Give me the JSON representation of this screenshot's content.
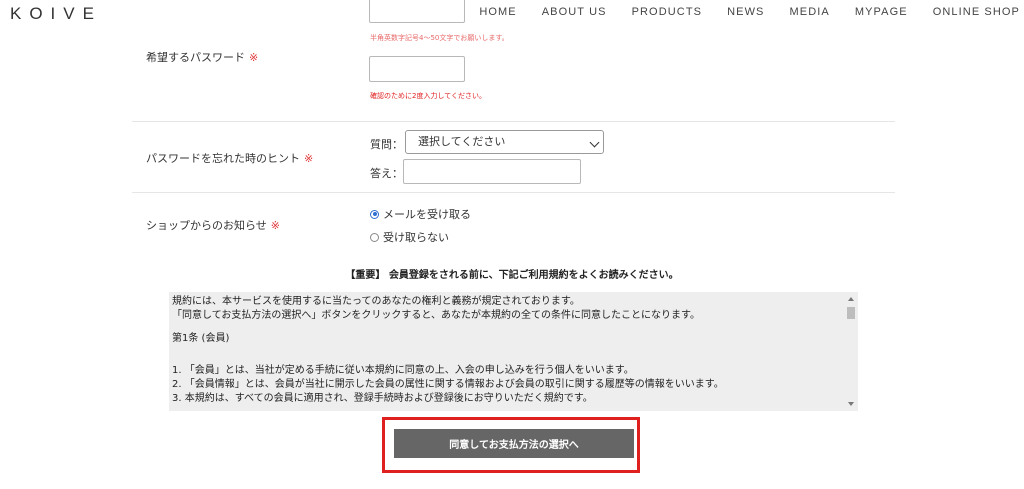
{
  "header": {
    "logo": "KOIVE",
    "nav": [
      "HOME",
      "ABOUT US",
      "PRODUCTS",
      "NEWS",
      "MEDIA",
      "MYPAGE",
      "ONLINE SHOP"
    ]
  },
  "password": {
    "label": "希望するパスワード",
    "required_mark": "※",
    "hint_format": "半角英数字記号4～50文字でお願いします。",
    "hint_confirm": "確認のために2度入力してください。",
    "value": "",
    "confirm_value": ""
  },
  "password_hint": {
    "label": "パスワードを忘れた時のヒント",
    "required_mark": "※",
    "question_label": "質問：",
    "question_selected": "選択してください",
    "answer_label": "答え：",
    "answer_value": ""
  },
  "newsletter": {
    "label": "ショップからのお知らせ",
    "required_mark": "※",
    "options": [
      {
        "label": "メールを受け取る",
        "selected": true
      },
      {
        "label": "受け取らない",
        "selected": false
      }
    ]
  },
  "terms": {
    "notice": "【重要】 会員登録をされる前に、下記ご利用規約をよくお読みください。",
    "lines": [
      "規約には、本サービスを使用するに当たってのあなたの権利と義務が規定されております。",
      "「同意してお支払方法の選択へ」ボタンをクリックすると、あなたが本規約の全ての条件に同意したことになります。",
      "第1条 (会員)",
      "1. 「会員」とは、当社が定める手続に従い本規約に同意の上、入会の申し込みを行う個人をいいます。",
      "2. 「会員情報」とは、会員が当社に開示した会員の属性に関する情報および会員の取引に関する履歴等の情報をいいます。",
      "3. 本規約は、すべての会員に適用され、登録手続時および登録後にお守りいただく規約です。"
    ]
  },
  "submit": {
    "label": "同意してお支払方法の選択へ"
  },
  "colors": {
    "required": "#e03a3a",
    "highlight": "#e0201e",
    "button": "#666666",
    "terms_bg": "#eeeeee"
  }
}
